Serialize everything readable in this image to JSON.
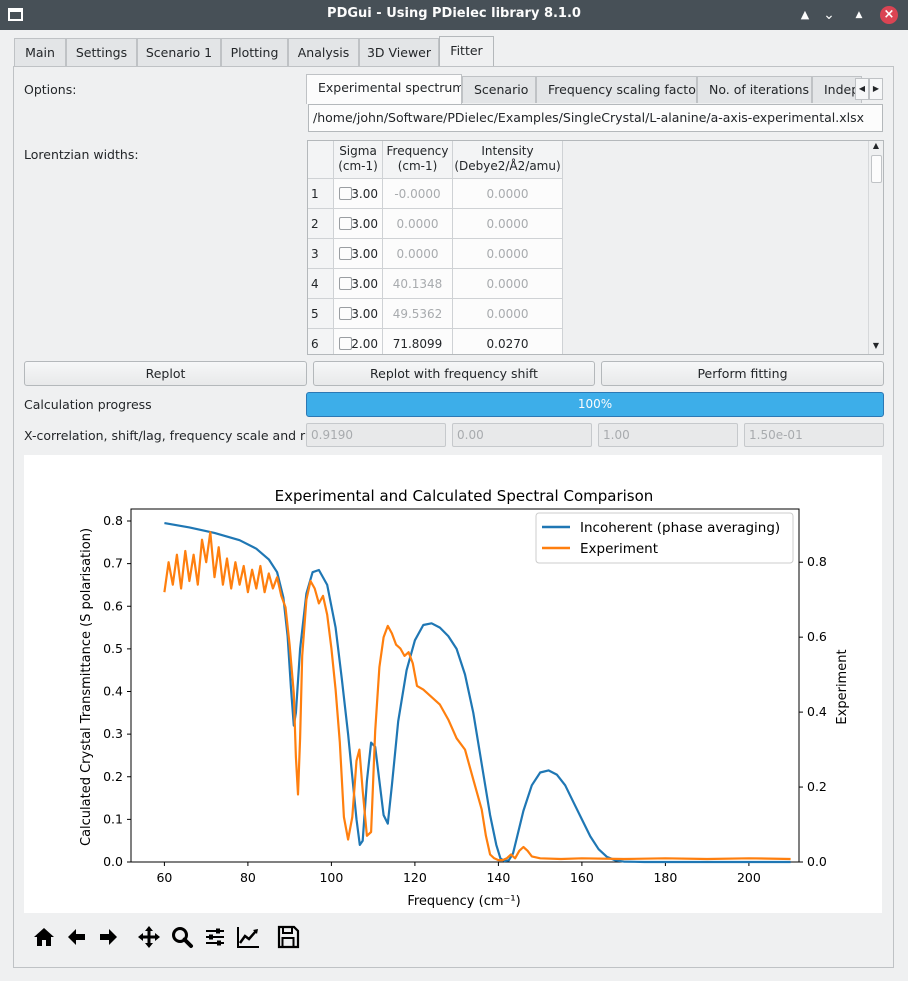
{
  "window": {
    "title": "PDGui - Using PDielec library 8.1.0"
  },
  "tabs": [
    {
      "label": "Main"
    },
    {
      "label": "Settings"
    },
    {
      "label": "Scenario 1"
    },
    {
      "label": "Plotting"
    },
    {
      "label": "Analysis"
    },
    {
      "label": "3D Viewer"
    },
    {
      "label": "Fitter"
    }
  ],
  "active_tab": "Fitter",
  "fitter": {
    "options_label": "Options:",
    "subtabs": [
      {
        "label": "Experimental spectrum"
      },
      {
        "label": "Scenario"
      },
      {
        "label": "Frequency scaling factor"
      },
      {
        "label": "No. of iterations"
      },
      {
        "label": "Indep"
      }
    ],
    "experiment_path": "/home/john/Software/PDielec/Examples/SingleCrystal/L-alanine/a-axis-experimental.xlsx",
    "lorentzian_label": "Lorentzian widths:",
    "table": {
      "headers": [
        "Sigma\n(cm-1)",
        "Frequency\n(cm-1)",
        "Intensity\n(Debye2/Å2/amu)"
      ],
      "rows": [
        {
          "n": "1",
          "sigma": "3.00",
          "freq": "-0.0000",
          "intensity": "0.0000",
          "checked": false
        },
        {
          "n": "2",
          "sigma": "3.00",
          "freq": "0.0000",
          "intensity": "0.0000",
          "checked": false
        },
        {
          "n": "3",
          "sigma": "3.00",
          "freq": "0.0000",
          "intensity": "0.0000",
          "checked": false
        },
        {
          "n": "4",
          "sigma": "3.00",
          "freq": "40.1348",
          "intensity": "0.0000",
          "checked": false
        },
        {
          "n": "5",
          "sigma": "3.00",
          "freq": "49.5362",
          "intensity": "0.0000",
          "checked": false
        },
        {
          "n": "6",
          "sigma": "2.00",
          "freq": "71.8099",
          "intensity": "0.0270",
          "checked": false
        }
      ]
    },
    "buttons": {
      "replot": "Replot",
      "replot_shift": "Replot with frequency shift",
      "perform_fitting": "Perform fitting"
    },
    "progress_label": "Calculation progress",
    "progress_text": "100%",
    "progress_value": 100,
    "xcorr_label": "X-correlation, shift/lag, frequency scale and rmse",
    "xcorr_values": [
      "0.9190",
      "0.00",
      "1.00",
      "1.50e-01"
    ]
  },
  "chart_data": {
    "type": "line",
    "title": "Experimental and Calculated Spectral Comparison",
    "xlabel": "Frequency (cm⁻¹)",
    "ylabel_left": "Calculated Crystal Transmittance (S polarisation)",
    "ylabel_right": "Experiment",
    "xlim": [
      52,
      212
    ],
    "ylim_left": [
      0,
      0.8
    ],
    "ylim_right": [
      0,
      0.91
    ],
    "xticks": [
      60,
      80,
      100,
      120,
      140,
      160,
      180,
      200
    ],
    "yticks_left": [
      0.0,
      0.1,
      0.2,
      0.3,
      0.4,
      0.5,
      0.6,
      0.7,
      0.8
    ],
    "yticks_right": [
      0.0,
      0.2,
      0.4,
      0.6,
      0.8
    ],
    "legend_position": "top-right",
    "series": [
      {
        "name": "Incoherent (phase averaging)",
        "color": "#1f77b4",
        "axis": "left",
        "x": [
          60,
          66,
          72,
          78,
          82,
          85,
          87,
          88.5,
          89.5,
          90.3,
          91,
          91.5,
          92.5,
          94,
          95.5,
          97,
          99,
          101,
          102.5,
          104,
          105,
          106,
          106.8,
          107.5,
          108.5,
          109.5,
          110.5,
          111.5,
          112.5,
          113.5,
          114.5,
          116,
          118,
          120,
          122,
          124,
          126,
          128,
          130,
          132,
          134,
          136,
          138,
          139.5,
          140.5,
          141.5,
          142.5,
          143.5,
          144.5,
          146,
          148,
          150,
          152,
          154,
          156,
          158,
          160,
          162,
          164,
          166,
          168,
          170,
          175,
          185,
          195,
          210
        ],
        "y": [
          0.795,
          0.785,
          0.772,
          0.755,
          0.735,
          0.71,
          0.68,
          0.62,
          0.53,
          0.41,
          0.32,
          0.35,
          0.5,
          0.63,
          0.68,
          0.685,
          0.65,
          0.55,
          0.43,
          0.3,
          0.2,
          0.1,
          0.04,
          0.05,
          0.19,
          0.28,
          0.27,
          0.19,
          0.11,
          0.09,
          0.18,
          0.33,
          0.45,
          0.52,
          0.556,
          0.56,
          0.55,
          0.53,
          0.5,
          0.44,
          0.35,
          0.23,
          0.11,
          0.04,
          0.008,
          0.002,
          0.004,
          0.02,
          0.06,
          0.12,
          0.18,
          0.21,
          0.215,
          0.205,
          0.18,
          0.14,
          0.1,
          0.06,
          0.03,
          0.012,
          0.004,
          0.001,
          0.0,
          0.0,
          0.0,
          0.0
        ]
      },
      {
        "name": "Experiment",
        "color": "#ff7f0e",
        "axis": "right",
        "x": [
          60,
          61,
          62,
          63,
          64,
          65,
          66,
          67,
          68,
          69,
          70,
          71,
          72,
          73,
          74,
          75,
          76,
          77,
          78,
          79,
          80,
          81,
          82,
          83,
          84,
          85,
          86,
          87,
          88,
          89,
          90,
          91,
          91.5,
          92,
          92.5,
          93,
          94,
          95,
          96,
          97,
          98,
          99,
          100,
          101,
          102,
          103,
          104,
          105,
          106,
          106.7,
          107.5,
          108.5,
          109.5,
          110.5,
          111.5,
          112.5,
          113.5,
          114.5,
          115.5,
          116.5,
          117.5,
          118.5,
          119.5,
          120.5,
          122,
          124,
          126,
          128,
          130,
          132,
          134,
          136,
          137,
          138,
          139,
          140,
          141,
          142,
          143,
          144,
          145,
          146,
          147,
          148,
          150,
          155,
          160,
          170,
          180,
          190,
          200,
          210
        ],
        "y": [
          0.72,
          0.8,
          0.74,
          0.82,
          0.73,
          0.83,
          0.75,
          0.82,
          0.74,
          0.86,
          0.8,
          0.88,
          0.76,
          0.84,
          0.74,
          0.81,
          0.73,
          0.8,
          0.74,
          0.79,
          0.72,
          0.78,
          0.73,
          0.79,
          0.72,
          0.77,
          0.73,
          0.76,
          0.71,
          0.68,
          0.58,
          0.45,
          0.28,
          0.18,
          0.33,
          0.55,
          0.7,
          0.75,
          0.73,
          0.69,
          0.71,
          0.66,
          0.57,
          0.46,
          0.32,
          0.12,
          0.06,
          0.12,
          0.27,
          0.3,
          0.19,
          0.07,
          0.08,
          0.35,
          0.52,
          0.6,
          0.63,
          0.61,
          0.58,
          0.57,
          0.55,
          0.56,
          0.53,
          0.47,
          0.46,
          0.44,
          0.42,
          0.38,
          0.33,
          0.3,
          0.22,
          0.14,
          0.07,
          0.02,
          0.01,
          0.005,
          0.005,
          0.01,
          0.02,
          0.01,
          0.03,
          0.04,
          0.03,
          0.015,
          0.01,
          0.008,
          0.01,
          0.008,
          0.01,
          0.008,
          0.01,
          0.008
        ]
      }
    ]
  },
  "plot_toolbar": [
    {
      "icon": "home-icon"
    },
    {
      "icon": "back-arrow-icon"
    },
    {
      "icon": "forward-arrow-icon"
    },
    {
      "icon": "pan-icon"
    },
    {
      "icon": "zoom-icon"
    },
    {
      "icon": "configure-subplots-icon"
    },
    {
      "icon": "edit-axis-icon"
    },
    {
      "icon": "save-icon"
    }
  ]
}
